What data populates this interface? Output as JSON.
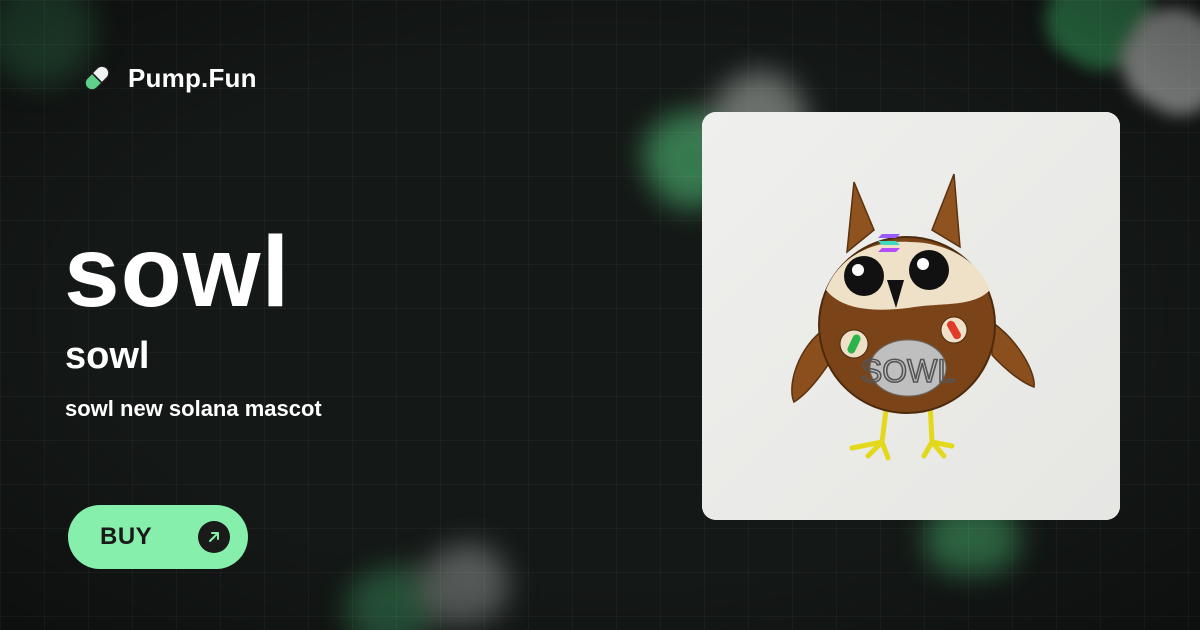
{
  "brand": {
    "name": "Pump.Fun",
    "icon": "pill-icon",
    "pill_green": "#5fd08a",
    "pill_white": "#f2f2f2"
  },
  "token": {
    "name": "sowl",
    "symbol": "sowl",
    "description": "sowl new solana mascot",
    "image_text": "SOWL"
  },
  "buy_button": {
    "label": "BUY",
    "icon": "arrow-up-right-icon",
    "color": "#86efac"
  },
  "colors": {
    "background": "#141816",
    "text": "#ffffff",
    "card": "#ececea"
  }
}
